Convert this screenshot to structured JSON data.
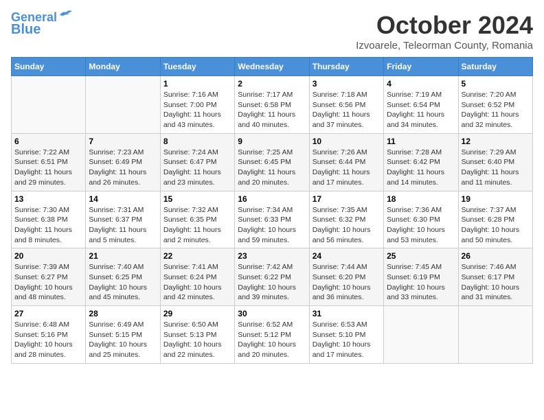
{
  "header": {
    "logo_line1": "General",
    "logo_line2": "Blue",
    "month": "October 2024",
    "location": "Izvoarele, Teleorman County, Romania"
  },
  "weekdays": [
    "Sunday",
    "Monday",
    "Tuesday",
    "Wednesday",
    "Thursday",
    "Friday",
    "Saturday"
  ],
  "weeks": [
    [
      {
        "day": "",
        "info": ""
      },
      {
        "day": "",
        "info": ""
      },
      {
        "day": "1",
        "info": "Sunrise: 7:16 AM\nSunset: 7:00 PM\nDaylight: 11 hours and 43 minutes."
      },
      {
        "day": "2",
        "info": "Sunrise: 7:17 AM\nSunset: 6:58 PM\nDaylight: 11 hours and 40 minutes."
      },
      {
        "day": "3",
        "info": "Sunrise: 7:18 AM\nSunset: 6:56 PM\nDaylight: 11 hours and 37 minutes."
      },
      {
        "day": "4",
        "info": "Sunrise: 7:19 AM\nSunset: 6:54 PM\nDaylight: 11 hours and 34 minutes."
      },
      {
        "day": "5",
        "info": "Sunrise: 7:20 AM\nSunset: 6:52 PM\nDaylight: 11 hours and 32 minutes."
      }
    ],
    [
      {
        "day": "6",
        "info": "Sunrise: 7:22 AM\nSunset: 6:51 PM\nDaylight: 11 hours and 29 minutes."
      },
      {
        "day": "7",
        "info": "Sunrise: 7:23 AM\nSunset: 6:49 PM\nDaylight: 11 hours and 26 minutes."
      },
      {
        "day": "8",
        "info": "Sunrise: 7:24 AM\nSunset: 6:47 PM\nDaylight: 11 hours and 23 minutes."
      },
      {
        "day": "9",
        "info": "Sunrise: 7:25 AM\nSunset: 6:45 PM\nDaylight: 11 hours and 20 minutes."
      },
      {
        "day": "10",
        "info": "Sunrise: 7:26 AM\nSunset: 6:44 PM\nDaylight: 11 hours and 17 minutes."
      },
      {
        "day": "11",
        "info": "Sunrise: 7:28 AM\nSunset: 6:42 PM\nDaylight: 11 hours and 14 minutes."
      },
      {
        "day": "12",
        "info": "Sunrise: 7:29 AM\nSunset: 6:40 PM\nDaylight: 11 hours and 11 minutes."
      }
    ],
    [
      {
        "day": "13",
        "info": "Sunrise: 7:30 AM\nSunset: 6:38 PM\nDaylight: 11 hours and 8 minutes."
      },
      {
        "day": "14",
        "info": "Sunrise: 7:31 AM\nSunset: 6:37 PM\nDaylight: 11 hours and 5 minutes."
      },
      {
        "day": "15",
        "info": "Sunrise: 7:32 AM\nSunset: 6:35 PM\nDaylight: 11 hours and 2 minutes."
      },
      {
        "day": "16",
        "info": "Sunrise: 7:34 AM\nSunset: 6:33 PM\nDaylight: 10 hours and 59 minutes."
      },
      {
        "day": "17",
        "info": "Sunrise: 7:35 AM\nSunset: 6:32 PM\nDaylight: 10 hours and 56 minutes."
      },
      {
        "day": "18",
        "info": "Sunrise: 7:36 AM\nSunset: 6:30 PM\nDaylight: 10 hours and 53 minutes."
      },
      {
        "day": "19",
        "info": "Sunrise: 7:37 AM\nSunset: 6:28 PM\nDaylight: 10 hours and 50 minutes."
      }
    ],
    [
      {
        "day": "20",
        "info": "Sunrise: 7:39 AM\nSunset: 6:27 PM\nDaylight: 10 hours and 48 minutes."
      },
      {
        "day": "21",
        "info": "Sunrise: 7:40 AM\nSunset: 6:25 PM\nDaylight: 10 hours and 45 minutes."
      },
      {
        "day": "22",
        "info": "Sunrise: 7:41 AM\nSunset: 6:24 PM\nDaylight: 10 hours and 42 minutes."
      },
      {
        "day": "23",
        "info": "Sunrise: 7:42 AM\nSunset: 6:22 PM\nDaylight: 10 hours and 39 minutes."
      },
      {
        "day": "24",
        "info": "Sunrise: 7:44 AM\nSunset: 6:20 PM\nDaylight: 10 hours and 36 minutes."
      },
      {
        "day": "25",
        "info": "Sunrise: 7:45 AM\nSunset: 6:19 PM\nDaylight: 10 hours and 33 minutes."
      },
      {
        "day": "26",
        "info": "Sunrise: 7:46 AM\nSunset: 6:17 PM\nDaylight: 10 hours and 31 minutes."
      }
    ],
    [
      {
        "day": "27",
        "info": "Sunrise: 6:48 AM\nSunset: 5:16 PM\nDaylight: 10 hours and 28 minutes."
      },
      {
        "day": "28",
        "info": "Sunrise: 6:49 AM\nSunset: 5:15 PM\nDaylight: 10 hours and 25 minutes."
      },
      {
        "day": "29",
        "info": "Sunrise: 6:50 AM\nSunset: 5:13 PM\nDaylight: 10 hours and 22 minutes."
      },
      {
        "day": "30",
        "info": "Sunrise: 6:52 AM\nSunset: 5:12 PM\nDaylight: 10 hours and 20 minutes."
      },
      {
        "day": "31",
        "info": "Sunrise: 6:53 AM\nSunset: 5:10 PM\nDaylight: 10 hours and 17 minutes."
      },
      {
        "day": "",
        "info": ""
      },
      {
        "day": "",
        "info": ""
      }
    ]
  ]
}
